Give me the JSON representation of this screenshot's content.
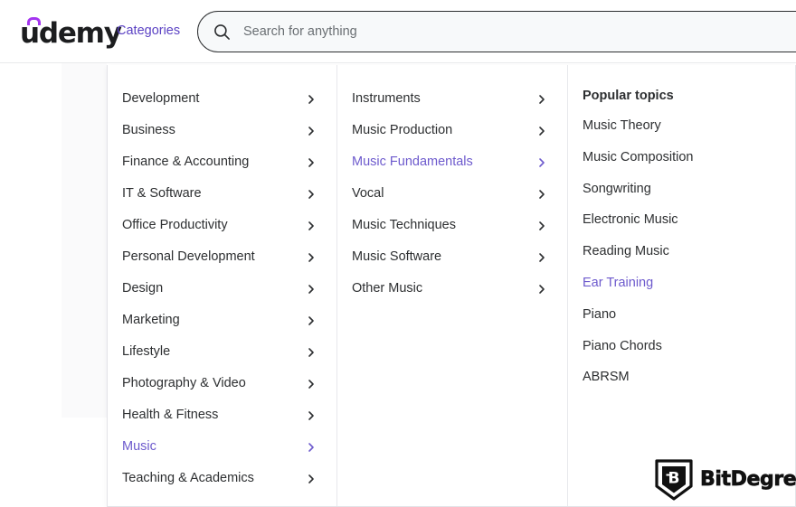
{
  "header": {
    "logo_text": "udemy",
    "logo_accent_color": "#a435f0",
    "categories_label": "Categories",
    "search": {
      "placeholder": "Search for anything",
      "value": "",
      "icon": "search-icon"
    }
  },
  "accent_purple": "#6d5acd",
  "link_purple": "#5b42c4",
  "dropdown": {
    "column_1": {
      "items": [
        {
          "label": "Development",
          "active": false,
          "icon": "chevron-right-icon"
        },
        {
          "label": "Business",
          "active": false,
          "icon": "chevron-right-icon"
        },
        {
          "label": "Finance & Accounting",
          "active": false,
          "icon": "chevron-right-icon"
        },
        {
          "label": "IT & Software",
          "active": false,
          "icon": "chevron-right-icon"
        },
        {
          "label": "Office Productivity",
          "active": false,
          "icon": "chevron-right-icon"
        },
        {
          "label": "Personal Development",
          "active": false,
          "icon": "chevron-right-icon"
        },
        {
          "label": "Design",
          "active": false,
          "icon": "chevron-right-icon"
        },
        {
          "label": "Marketing",
          "active": false,
          "icon": "chevron-right-icon"
        },
        {
          "label": "Lifestyle",
          "active": false,
          "icon": "chevron-right-icon"
        },
        {
          "label": "Photography & Video",
          "active": false,
          "icon": "chevron-right-icon"
        },
        {
          "label": "Health & Fitness",
          "active": false,
          "icon": "chevron-right-icon"
        },
        {
          "label": "Music",
          "active": true,
          "icon": "chevron-right-icon"
        },
        {
          "label": "Teaching & Academics",
          "active": false,
          "icon": "chevron-right-icon"
        }
      ]
    },
    "column_2": {
      "items": [
        {
          "label": "Instruments",
          "active": false,
          "icon": "chevron-right-icon"
        },
        {
          "label": "Music Production",
          "active": false,
          "icon": "chevron-right-icon"
        },
        {
          "label": "Music Fundamentals",
          "active": true,
          "icon": "chevron-right-icon"
        },
        {
          "label": "Vocal",
          "active": false,
          "icon": "chevron-right-icon"
        },
        {
          "label": "Music Techniques",
          "active": false,
          "icon": "chevron-right-icon"
        },
        {
          "label": "Music Software",
          "active": false,
          "icon": "chevron-right-icon"
        },
        {
          "label": "Other Music",
          "active": false,
          "icon": "chevron-right-icon"
        }
      ]
    },
    "column_3": {
      "heading": "Popular topics",
      "items": [
        {
          "label": "Music Theory",
          "active": false
        },
        {
          "label": "Music Composition",
          "active": false
        },
        {
          "label": "Songwriting",
          "active": false
        },
        {
          "label": "Electronic Music",
          "active": false
        },
        {
          "label": "Reading Music",
          "active": false
        },
        {
          "label": "Ear Training",
          "active": true
        },
        {
          "label": "Piano",
          "active": false
        },
        {
          "label": "Piano Chords",
          "active": false
        },
        {
          "label": "ABRSM",
          "active": false
        }
      ]
    }
  },
  "watermark": {
    "brand": "BitDegree",
    "shield_letter": "B"
  }
}
